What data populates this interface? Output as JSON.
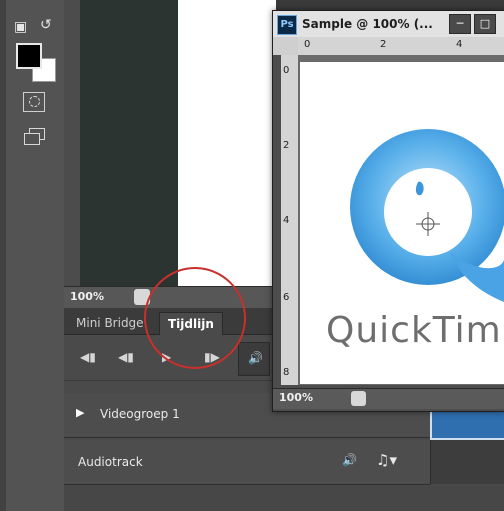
{
  "status_bar": {
    "back_zoom": "100%",
    "doc_zoom": "100%"
  },
  "panel": {
    "tabs": [
      {
        "label": "Mini Bridge"
      },
      {
        "label": "Tijdlijn"
      }
    ],
    "tracks": [
      {
        "label": "Videogroep 1"
      },
      {
        "label": "Audiotrack"
      }
    ]
  },
  "document": {
    "title": "Sample @ 100% (...",
    "ps_label": "Ps",
    "ruler_h": [
      "0",
      "2",
      "4"
    ],
    "ruler_v": [
      "0",
      "2",
      "4",
      "6",
      "8"
    ],
    "canvas_text": "QuickTim"
  },
  "colors": {
    "foreground": "#000000",
    "background": "#ffffff",
    "highlight_circle": "#c8302c",
    "logo_blue": "#3f9be0"
  }
}
